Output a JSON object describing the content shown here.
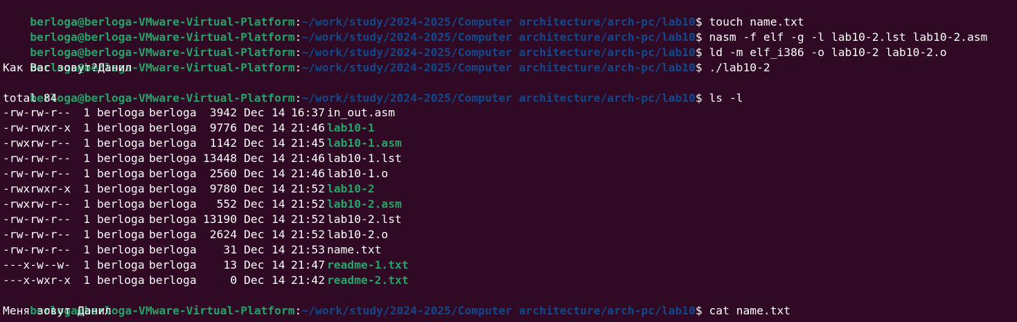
{
  "colors": {
    "background": "#300a24",
    "prompt_user": "#26a269",
    "prompt_path": "#12488b",
    "text": "#ffffff",
    "executable": "#26a269"
  },
  "prompt": {
    "user_host": "berloga@berloga-VMware-Virtual-Platform",
    "separator": ":",
    "path": "~/work/study/2024-2025/Computer architecture/arch-pc/lab10",
    "symbol": "$ "
  },
  "commands": [
    "touch name.txt",
    "nasm -f elf -g -l lab10-2.lst lab10-2.asm",
    "ld -m elf_i386 -o lab10-2 lab10-2.o",
    "./lab10-2",
    "ls -l",
    "cat name.txt"
  ],
  "program_output": "Как Вас зовут?Данил",
  "ls_total": "total 84",
  "ls_entries": [
    {
      "perms": "-rw-rw-r--",
      "links": "1",
      "owner": "berloga",
      "group": "berloga",
      "size": "3942",
      "month": "Dec",
      "day": "14",
      "time": "16:37",
      "name": "in_out.asm",
      "exec": false
    },
    {
      "perms": "-rw-rwxr-x",
      "links": "1",
      "owner": "berloga",
      "group": "berloga",
      "size": "9776",
      "month": "Dec",
      "day": "14",
      "time": "21:46",
      "name": "lab10-1",
      "exec": true
    },
    {
      "perms": "-rwxrw-r--",
      "links": "1",
      "owner": "berloga",
      "group": "berloga",
      "size": "1142",
      "month": "Dec",
      "day": "14",
      "time": "21:45",
      "name": "lab10-1.asm",
      "exec": true
    },
    {
      "perms": "-rw-rw-r--",
      "links": "1",
      "owner": "berloga",
      "group": "berloga",
      "size": "13448",
      "month": "Dec",
      "day": "14",
      "time": "21:46",
      "name": "lab10-1.lst",
      "exec": false
    },
    {
      "perms": "-rw-rw-r--",
      "links": "1",
      "owner": "berloga",
      "group": "berloga",
      "size": "2560",
      "month": "Dec",
      "day": "14",
      "time": "21:46",
      "name": "lab10-1.o",
      "exec": false
    },
    {
      "perms": "-rwxrwxr-x",
      "links": "1",
      "owner": "berloga",
      "group": "berloga",
      "size": "9780",
      "month": "Dec",
      "day": "14",
      "time": "21:52",
      "name": "lab10-2",
      "exec": true
    },
    {
      "perms": "-rwxrw-r--",
      "links": "1",
      "owner": "berloga",
      "group": "berloga",
      "size": "552",
      "month": "Dec",
      "day": "14",
      "time": "21:52",
      "name": "lab10-2.asm",
      "exec": true
    },
    {
      "perms": "-rw-rw-r--",
      "links": "1",
      "owner": "berloga",
      "group": "berloga",
      "size": "13190",
      "month": "Dec",
      "day": "14",
      "time": "21:52",
      "name": "lab10-2.lst",
      "exec": false
    },
    {
      "perms": "-rw-rw-r--",
      "links": "1",
      "owner": "berloga",
      "group": "berloga",
      "size": "2624",
      "month": "Dec",
      "day": "14",
      "time": "21:52",
      "name": "lab10-2.o",
      "exec": false
    },
    {
      "perms": "-rw-rw-r--",
      "links": "1",
      "owner": "berloga",
      "group": "berloga",
      "size": "31",
      "month": "Dec",
      "day": "14",
      "time": "21:53",
      "name": "name.txt",
      "exec": false
    },
    {
      "perms": "---x-w--w-",
      "links": "1",
      "owner": "berloga",
      "group": "berloga",
      "size": "13",
      "month": "Dec",
      "day": "14",
      "time": "21:47",
      "name": "readme-1.txt",
      "exec": true
    },
    {
      "perms": "---x-wxr-x",
      "links": "1",
      "owner": "berloga",
      "group": "berloga",
      "size": "0",
      "month": "Dec",
      "day": "14",
      "time": "21:42",
      "name": "readme-2.txt",
      "exec": true
    }
  ],
  "cat_output": "Меня зовут Данил"
}
